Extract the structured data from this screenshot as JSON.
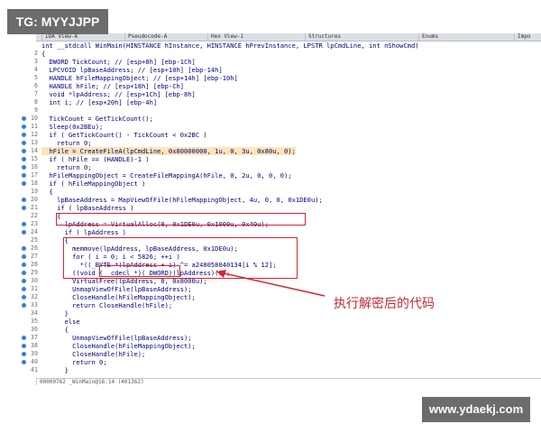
{
  "tabs": [
    {
      "label": "IDA View-A"
    },
    {
      "label": "Pseudocode-A"
    },
    {
      "label": "Hex View-1"
    },
    {
      "label": "Structures"
    },
    {
      "label": "Enums"
    },
    {
      "label": "Impo"
    }
  ],
  "code_lines": [
    {
      "n": "",
      "text": "int __stdcall WinMain(HINSTANCE hInstance, HINSTANCE hPrevInstance, LPSTR lpCmdLine, int nShowCmd)",
      "dot": false
    },
    {
      "n": "2",
      "text": "{",
      "dot": false
    },
    {
      "n": "3",
      "text": "  DWORD TickCount; // [esp+8h] [ebp-1Ch]",
      "dot": false
    },
    {
      "n": "4",
      "text": "  LPCVOID lpBaseAddress; // [esp+10h] [ebp-14h]",
      "dot": false
    },
    {
      "n": "5",
      "text": "  HANDLE hFileMappingObject; // [esp+14h] [ebp-10h]",
      "dot": false
    },
    {
      "n": "6",
      "text": "  HANDLE hFile; // [esp+18h] [ebp-Ch]",
      "dot": false
    },
    {
      "n": "7",
      "text": "  void *lpAddress; // [esp+1Ch] [ebp-8h]",
      "dot": false
    },
    {
      "n": "8",
      "text": "  int i; // [esp+20h] [ebp-4h]",
      "dot": false
    },
    {
      "n": "9",
      "text": "",
      "dot": false
    },
    {
      "n": "10",
      "text": "  TickCount = GetTickCount();",
      "dot": true
    },
    {
      "n": "11",
      "text": "  Sleep(0x2BEu);",
      "dot": true
    },
    {
      "n": "12",
      "text": "  if ( GetTickCount() - TickCount < 0x2BC )",
      "dot": true
    },
    {
      "n": "13",
      "text": "    return 0;",
      "dot": true
    },
    {
      "n": "14",
      "text": "  hFile = CreateFileA(lpCmdLine, 0x80000000, 1u, 0, 3u, 0x80u, 0);",
      "dot": true,
      "hl": true
    },
    {
      "n": "15",
      "text": "  if ( hFile == (HANDLE)-1 )",
      "dot": true
    },
    {
      "n": "16",
      "text": "    return 0;",
      "dot": true
    },
    {
      "n": "17",
      "text": "  hFileMappingObject = CreateFileMappingA(hFile, 0, 2u, 0, 0, 0);",
      "dot": true
    },
    {
      "n": "18",
      "text": "  if ( hFileMappingObject )",
      "dot": true
    },
    {
      "n": "19",
      "text": "  {",
      "dot": false
    },
    {
      "n": "20",
      "text": "    lpBaseAddress = MapViewOfFile(hFileMappingObject, 4u, 0, 0, 0x1DE0u);",
      "dot": true
    },
    {
      "n": "21",
      "text": "    if ( lpBaseAddress )",
      "dot": true
    },
    {
      "n": "22",
      "text": "    {",
      "dot": false
    },
    {
      "n": "23",
      "text": "      lpAddress = VirtualAlloc(0, 0x1DE0u, 0x1000u, 0x40u);",
      "dot": true
    },
    {
      "n": "24",
      "text": "      if ( lpAddress )",
      "dot": true
    },
    {
      "n": "25",
      "text": "      {",
      "dot": false
    },
    {
      "n": "26",
      "text": "        memmove(lpAddress, lpBaseAddress, 0x1DE0u);",
      "dot": true
    },
    {
      "n": "27",
      "text": "        for ( i = 0; i < 5826; ++i )",
      "dot": true
    },
    {
      "n": "28",
      "text": "          *((_BYTE *)lpAddress + i) ^= a248058040134[i % 12];",
      "dot": true
    },
    {
      "n": "29",
      "text": "        ((void (__cdecl *)(_DWORD))lpAddress)(0);",
      "dot": true
    },
    {
      "n": "30",
      "text": "        VirtualFree(lpAddress, 0, 0x8000u);",
      "dot": true
    },
    {
      "n": "31",
      "text": "        UnmapViewOfFile(lpBaseAddress);",
      "dot": true
    },
    {
      "n": "32",
      "text": "        CloseHandle(hFileMappingObject);",
      "dot": true
    },
    {
      "n": "33",
      "text": "        return CloseHandle(hFile);",
      "dot": true
    },
    {
      "n": "34",
      "text": "      }",
      "dot": false
    },
    {
      "n": "35",
      "text": "      else",
      "dot": false
    },
    {
      "n": "36",
      "text": "      {",
      "dot": false
    },
    {
      "n": "37",
      "text": "        UnmapViewOfFile(lpBaseAddress);",
      "dot": true
    },
    {
      "n": "38",
      "text": "        CloseHandle(hFileMappingObject);",
      "dot": true
    },
    {
      "n": "39",
      "text": "        CloseHandle(hFile);",
      "dot": true
    },
    {
      "n": "40",
      "text": "        return 0;",
      "dot": true
    },
    {
      "n": "41",
      "text": "      }",
      "dot": false
    },
    {
      "n": "",
      "text": "    }",
      "dot": false
    }
  ],
  "annotation": "执行解密后的代码",
  "status_bar": "00000762 _WinMain@16:14 (401362)",
  "watermark_top": "TG: MYYJJPP",
  "watermark_bottom": "www.ydaekj.com",
  "colors": {
    "highlight": "#ffe4b5",
    "box": "#d9242f",
    "comment": "#4a9a4a",
    "function": "#e03a8a",
    "text": "#000080"
  }
}
